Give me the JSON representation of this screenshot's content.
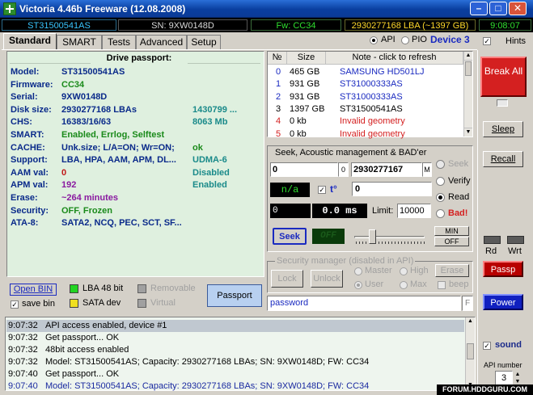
{
  "window": {
    "title": "Victoria 4.46b Freeware (12.08.2008)",
    "min": "–",
    "max": "□",
    "close": "✕"
  },
  "status": {
    "model": "ST31500541AS",
    "sn": "SN: 9XW0148D",
    "fw": "Fw: CC34",
    "lba": "2930277168 LBA (~1397 GB)",
    "time": "9:08:07"
  },
  "tabs": [
    "Standard",
    "SMART",
    "Tests",
    "Advanced",
    "Setup"
  ],
  "interface": {
    "api": "API",
    "pio": "PIO",
    "device": "Device 3",
    "hints": "Hints"
  },
  "passport": {
    "header": "Drive passport:",
    "rows": [
      {
        "label": "Model:",
        "value": "ST31500541AS",
        "extra": "",
        "extra2": ""
      },
      {
        "label": "Firmware:",
        "value": "CC34",
        "extra": "",
        "extra2": ""
      },
      {
        "label": "Serial:",
        "value": "9XW0148D",
        "extra": "",
        "extra2": ""
      },
      {
        "label": "Disk size:",
        "value": "2930277168 LBAs",
        "extra": "1430799 ...",
        "extra2": ""
      },
      {
        "label": "CHS:",
        "value": "16383/16/63",
        "extra": "8063 Mb",
        "extra2": ""
      },
      {
        "label": "SMART:",
        "value": "Enabled, Errlog, Selftest",
        "extra": "",
        "extra2": ""
      },
      {
        "label": "CACHE:",
        "value": "Unk.size; L/A=ON; Wr=ON;",
        "extra": "ok",
        "extra2": ""
      },
      {
        "label": "Support:",
        "value": "LBA, HPA, AAM, APM, DL...",
        "extra": "UDMA-6",
        "extra2": ""
      },
      {
        "label": "AAM val:",
        "value": "0",
        "extra": "Disabled",
        "extra2": ""
      },
      {
        "label": "APM val:",
        "value": "192",
        "extra": "Enabled",
        "extra2": ""
      },
      {
        "label": "Erase:",
        "value": "~264 minutes",
        "extra": "",
        "extra2": ""
      },
      {
        "label": "Security:",
        "value": "OFF, Frozen",
        "extra": "",
        "extra2": ""
      },
      {
        "label": "ATA-8:",
        "value": "SATA2, NCQ, PEC, SCT, SF...",
        "extra": "",
        "extra2": ""
      }
    ]
  },
  "devices": {
    "headers": [
      "№",
      "Size",
      "Note - click to refresh"
    ],
    "rows": [
      {
        "n": "0",
        "size": "465 GB",
        "note": "SAMSUNG HD501LJ"
      },
      {
        "n": "1",
        "size": "931 GB",
        "note": "ST31000333AS"
      },
      {
        "n": "2",
        "size": "931 GB",
        "note": "ST31000333AS"
      },
      {
        "n": "3",
        "size": "1397 GB",
        "note": "ST31500541AS"
      },
      {
        "n": "4",
        "size": "0 kb",
        "note": "Invalid geometry"
      },
      {
        "n": "5",
        "size": "0 kb",
        "note": "Invalid geometry"
      }
    ]
  },
  "seek": {
    "title": "Seek, Acoustic management & BAD'er",
    "start": "0",
    "start_unit": "0",
    "end": "2930277167",
    "end_unit": "M",
    "na": "n/a",
    "temp_label": "t°",
    "value2": "0",
    "count": "0",
    "ms": "0.0 ms",
    "limit_label": "Limit:",
    "limit": "10000",
    "seek_btn": "Seek",
    "off_display": "OFF",
    "min": "MIN",
    "off": "OFF",
    "radios": [
      "Seek",
      "Verify",
      "Read",
      "Bad!"
    ]
  },
  "security": {
    "title": "Security manager (disabled in API)",
    "lock": "Lock",
    "unlock": "Unlock",
    "erase": "Erase",
    "master": "Master",
    "high": "High",
    "user": "User",
    "max": "Max",
    "beep": "beep",
    "password": "password",
    "f": "F"
  },
  "bottom": {
    "open_bin": "Open BIN",
    "save_bin": "save bin",
    "lba48": "LBA 48 bit",
    "removable": "Removable",
    "sata": "SATA dev",
    "virtual": "Virtual",
    "passport": "Passport"
  },
  "log": [
    {
      "time": "9:07:32",
      "msg": "API access enabled, device #1",
      "color": "#000"
    },
    {
      "time": "9:07:32",
      "msg": "Get passport... OK",
      "color": "#000"
    },
    {
      "time": "9:07:32",
      "msg": "48bit access enabled",
      "color": "#000"
    },
    {
      "time": "9:07:32",
      "msg": "Model: ST31500541AS; Capacity: 2930277168 LBAs; SN: 9XW0148D; FW: CC34",
      "color": "#000"
    },
    {
      "time": "9:07:40",
      "msg": "Get passport... OK",
      "color": "#000"
    },
    {
      "time": "9:07:40",
      "msg": "Model: ST31500541AS; Capacity: 2930277168 LBAs; SN: 9XW0148D; FW: CC34",
      "color": "#1a2aa0"
    }
  ],
  "right": {
    "break_all": "Break All",
    "sleep": "Sleep",
    "recall": "Recall",
    "rd": "Rd",
    "wrt": "Wrt",
    "passp": "Passp",
    "power": "Power",
    "sound": "sound",
    "api_number": "API number",
    "api_num_val": "3"
  },
  "watermark": "FORUM.HDDGURU.COM",
  "colors": {
    "accent": "#0a2a8a",
    "break": "#d42020",
    "power": "#1020c0"
  }
}
